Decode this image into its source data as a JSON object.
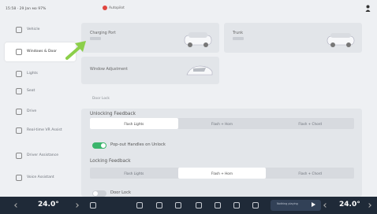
{
  "status_bar": {
    "text": "15:58 · 29 Jan  ᴍᴏ  97%",
    "badge": "Autopilot"
  },
  "sidebar": {
    "items": [
      {
        "label": "Vehicle"
      },
      {
        "label": "Windows & Door",
        "active": true
      },
      {
        "label": "Lights"
      },
      {
        "label": "Seat"
      },
      {
        "label": "Drive"
      },
      {
        "label": "Real-time VR Assist"
      },
      {
        "label": "Driver Assistance"
      },
      {
        "label": "Voice Assistant"
      }
    ]
  },
  "cards": {
    "charging_port": {
      "label": "Charging Port"
    },
    "trunk": {
      "label": "Trunk"
    },
    "window": {
      "label": "Window Adjustment"
    }
  },
  "section_title": "Door Lock",
  "unlocking": {
    "label": "Unlocking Feedback",
    "options": [
      "Flash Lights",
      "Flash + Horn",
      "Flash + Chord"
    ],
    "selected": 0
  },
  "pocket_unlock": {
    "label": "Pop-out Handles on Unlock",
    "on": true
  },
  "locking": {
    "label": "Locking Feedback",
    "options": [
      "Flash Lights",
      "Flash + Horn",
      "Flash + Chord"
    ],
    "selected": 1
  },
  "door_lock": {
    "label": "Door Lock",
    "on": false
  },
  "dock": {
    "temp_left": "24.0°",
    "temp_right": "24.0°",
    "media_label": "Nothing playing"
  },
  "colors": {
    "accent_green": "#3bb56c",
    "dock_bg": "#1f2a38",
    "arrow": "#8ccf4a"
  }
}
